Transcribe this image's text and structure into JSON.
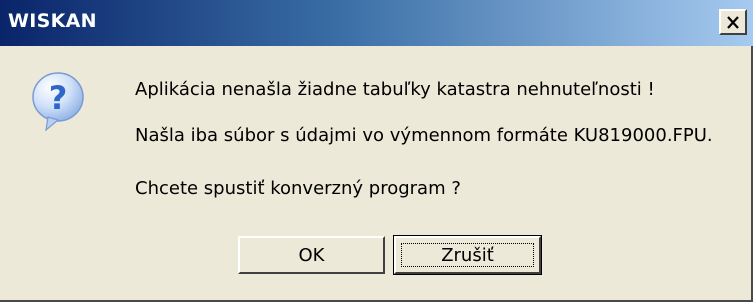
{
  "window": {
    "title": "WISKAN"
  },
  "icons": {
    "dialog_icon": "question-icon",
    "close_icon": "close-icon"
  },
  "message": {
    "line1": "Aplikácia nenašla žiadne tabuľky katastra nehnuteľnosti !",
    "line2": "Našla iba súbor s údajmi vo výmennom formáte KU819000.FPU.",
    "line3": "Chcete spustiť konverzný program ?"
  },
  "buttons": {
    "ok_label": "OK",
    "cancel_label": "Zrušiť"
  },
  "colors": {
    "titlebar_start": "#0a246a",
    "titlebar_end": "#a6caf0",
    "dialog_bg": "#ece9d8",
    "icon_blue": "#2f66c8"
  }
}
